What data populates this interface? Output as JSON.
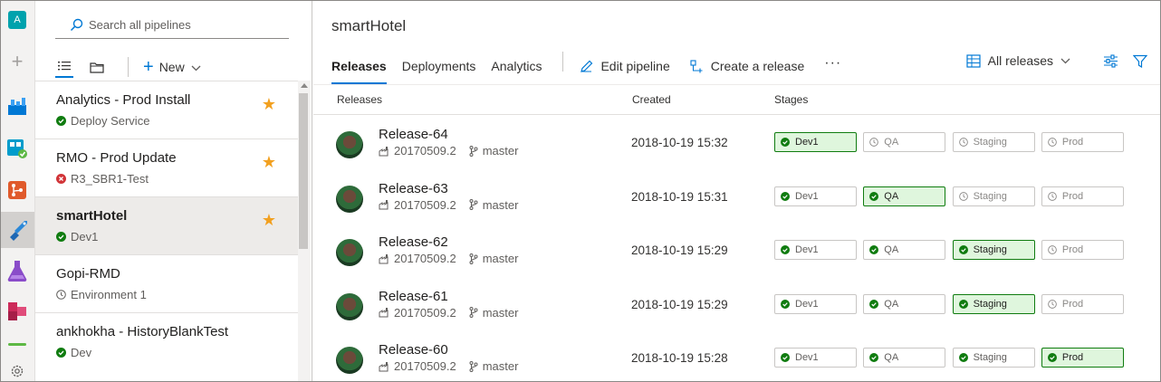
{
  "rail": {
    "avatar_letter": "A"
  },
  "search": {
    "placeholder": "Search all pipelines"
  },
  "pane_toolbar": {
    "new_label": "New"
  },
  "pipelines": [
    {
      "name": "Analytics - Prod Install",
      "status": "Deploy Service",
      "status_icon": "success-check-icon",
      "favorite": true
    },
    {
      "name": "RMO - Prod Update",
      "status": "R3_SBR1-Test",
      "status_icon": "error-x-icon",
      "favorite": true
    },
    {
      "name": "smartHotel",
      "status": "Dev1",
      "status_icon": "success-check-icon",
      "favorite": true,
      "selected": true
    },
    {
      "name": "Gopi-RMD",
      "status": "Environment 1",
      "status_icon": "clock-icon",
      "favorite": false
    },
    {
      "name": "ankhokha - HistoryBlankTest",
      "status": "Dev",
      "status_icon": "success-check-icon",
      "favorite": false
    }
  ],
  "main": {
    "title": "smartHotel",
    "tabs": [
      "Releases",
      "Deployments",
      "Analytics"
    ],
    "commands": {
      "edit": "Edit pipeline",
      "create": "Create a release",
      "more": "···"
    },
    "filter": "All releases",
    "columns": {
      "releases": "Releases",
      "created": "Created",
      "stages": "Stages"
    }
  },
  "stage_names": [
    "Dev1",
    "QA",
    "Staging",
    "Prod"
  ],
  "releases": [
    {
      "name": "Release-64",
      "build": "20170509.2",
      "branch": "master",
      "created": "2018-10-19 15:32",
      "current_stage": 0
    },
    {
      "name": "Release-63",
      "build": "20170509.2",
      "branch": "master",
      "created": "2018-10-19 15:31",
      "current_stage": 1
    },
    {
      "name": "Release-62",
      "build": "20170509.2",
      "branch": "master",
      "created": "2018-10-19 15:29",
      "current_stage": 2
    },
    {
      "name": "Release-61",
      "build": "20170509.2",
      "branch": "master",
      "created": "2018-10-19 15:29",
      "current_stage": 2
    },
    {
      "name": "Release-60",
      "build": "20170509.2",
      "branch": "master",
      "created": "2018-10-19 15:28",
      "current_stage": 3
    }
  ],
  "colors": {
    "accent": "#0078d4",
    "success": "#107c10",
    "error": "#d13438",
    "star": "#f2a01f"
  }
}
